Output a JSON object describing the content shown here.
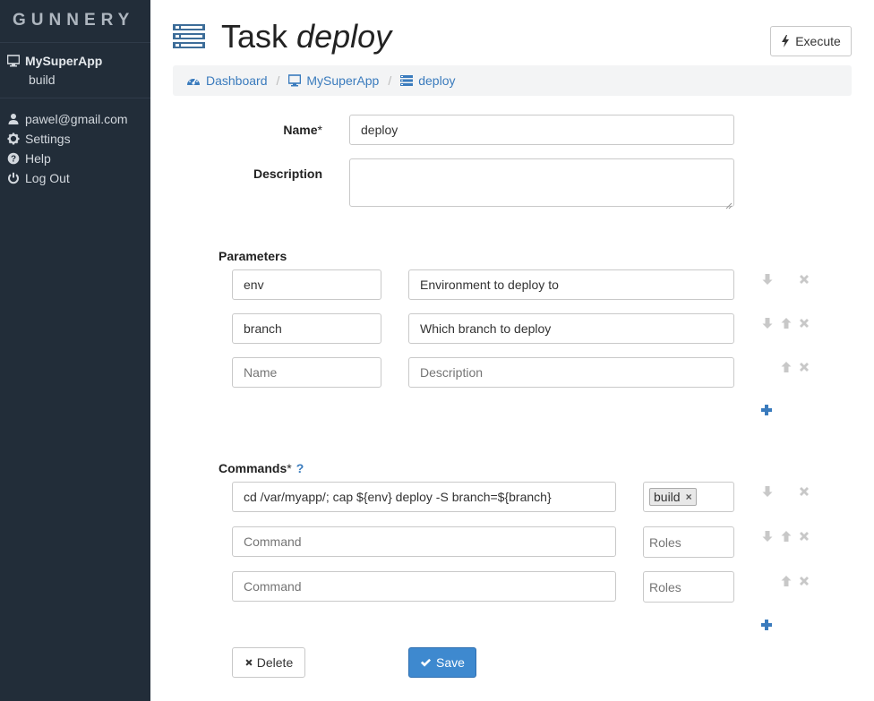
{
  "sidebar": {
    "brand": "GUNNERY",
    "app_name": "MySuperApp",
    "app_sub": "build",
    "user_items": [
      {
        "label": "pawel@gmail.com",
        "icon": "user-icon"
      },
      {
        "label": "Settings",
        "icon": "gear-icon"
      },
      {
        "label": "Help",
        "icon": "question-circle-icon"
      },
      {
        "label": "Log Out",
        "icon": "power-icon"
      }
    ]
  },
  "header": {
    "title_prefix": "Task",
    "title_name": "deploy",
    "execute_label": "Execute"
  },
  "breadcrumb": [
    {
      "label": "Dashboard",
      "icon": "dashboard-icon"
    },
    {
      "label": "MySuperApp",
      "icon": "monitor-icon"
    },
    {
      "label": "deploy",
      "icon": "task-list-icon"
    }
  ],
  "breadcrumb_separator": "/",
  "form": {
    "name_label": "Name",
    "required_mark": "*",
    "name_value": "deploy",
    "description_label": "Description",
    "description_value": ""
  },
  "parameters": {
    "title": "Parameters",
    "rows": [
      {
        "name": "env",
        "description": "Environment to deploy to"
      },
      {
        "name": "branch",
        "description": "Which branch to deploy"
      },
      {
        "name": "",
        "description": ""
      }
    ],
    "name_placeholder": "Name",
    "description_placeholder": "Description"
  },
  "commands": {
    "title": "Commands",
    "help": "?",
    "rows": [
      {
        "command": "cd /var/myapp/; cap ${env} deploy -S branch=${branch}",
        "roles": [
          "build"
        ]
      },
      {
        "command": "",
        "roles": []
      },
      {
        "command": "",
        "roles": []
      }
    ],
    "command_placeholder": "Command",
    "roles_placeholder": "Roles",
    "tag_remove": "×"
  },
  "actions": {
    "delete_label": "Delete",
    "save_label": "Save"
  },
  "colors": {
    "sidebar_bg": "#222d39",
    "link": "#3a7bbd",
    "primary": "#3e89cf",
    "control_gray": "#c8c8c8"
  }
}
